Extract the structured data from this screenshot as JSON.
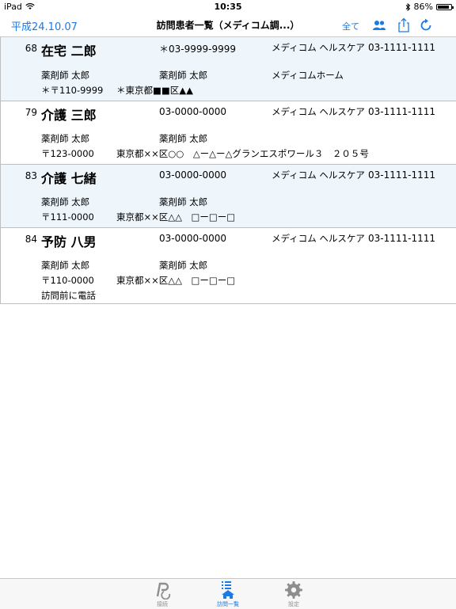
{
  "statusbar": {
    "device": "iPad",
    "time": "10:35",
    "battery": "86%",
    "battery_level": 0.86
  },
  "navbar": {
    "date": "平成24.10.07",
    "title": "訪問患者一覧（メディコム調...）",
    "all_label": "全て",
    "accent": "#1a7ae6"
  },
  "patients": [
    {
      "num": "68",
      "name": "在宅 二郎",
      "phone": "＊03-9999-9999",
      "facility": "メディコム ヘルスケア",
      "facility_phone": "03-1111-1111",
      "pharm1": "薬剤師 太郎",
      "pharm2": "薬剤師 太郎",
      "home": "メディコムホーム",
      "zip": "＊〒110-9999",
      "addr": "＊東京都■■区▲▲",
      "note": ""
    },
    {
      "num": "79",
      "name": "介護 三郎",
      "phone": "03-0000-0000",
      "facility": "メディコム ヘルスケア",
      "facility_phone": "03-1111-1111",
      "pharm1": "薬剤師 太郎",
      "pharm2": "薬剤師 太郎",
      "home": "",
      "zip": "〒123-0000",
      "addr": "東京都××区○○　△ー△ー△グランエスポワール３　２０５号",
      "note": ""
    },
    {
      "num": "83",
      "name": "介護 七緒",
      "phone": "03-0000-0000",
      "facility": "メディコム ヘルスケア",
      "facility_phone": "03-1111-1111",
      "pharm1": "薬剤師 太郎",
      "pharm2": "薬剤師 太郎",
      "home": "",
      "zip": "〒111-0000",
      "addr": "東京都××区△△　□ー□ー□",
      "note": ""
    },
    {
      "num": "84",
      "name": "予防 八男",
      "phone": "03-0000-0000",
      "facility": "メディコム ヘルスケア",
      "facility_phone": "03-1111-1111",
      "pharm1": "薬剤師 太郎",
      "pharm2": "薬剤師 太郎",
      "home": "",
      "zip": "〒110-0000",
      "addr": "東京都××区△△　□ー□ー□",
      "note": "訪問前に電話"
    }
  ],
  "tabbar": {
    "items": [
      {
        "label": "接続",
        "icon": "connect-icon"
      },
      {
        "label": "訪問一覧",
        "icon": "home-list-icon"
      },
      {
        "label": "設定",
        "icon": "gear-icon"
      }
    ]
  }
}
